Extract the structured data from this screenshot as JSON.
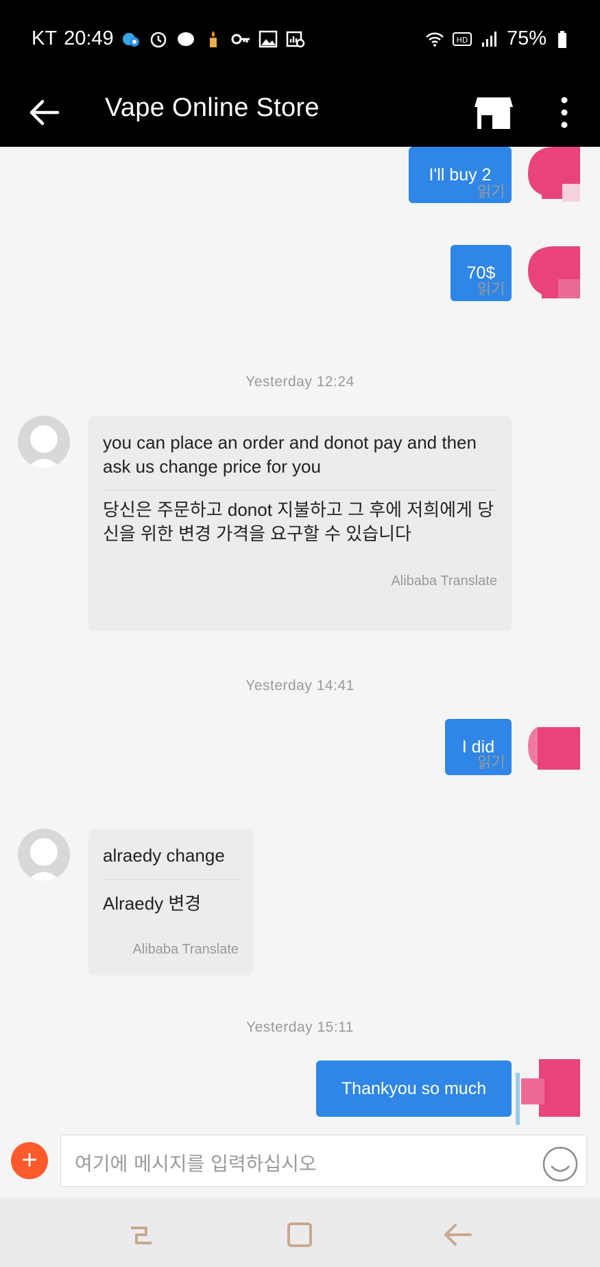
{
  "status_bar": {
    "carrier": "KT",
    "time": "20:49",
    "battery": "75%"
  },
  "header": {
    "title": "Vape Online Store"
  },
  "messages": {
    "m1_text": "I'll buy 2",
    "m1_status": "읽기",
    "m2_text": "70$",
    "m2_status": "읽기",
    "t1": "Yesterday 12:24",
    "m3_original": "you can place an order and donot pay and then ask us change price for you",
    "m3_translation": "당신은 주문하고 donot 지불하고 그 후에 저희에게 당신을 위한 변경 가격을 요구할 수 있습니다",
    "m3_credit": "Alibaba Translate",
    "t2": "Yesterday 14:41",
    "m4_text": "I did",
    "m4_status": "읽기",
    "m5_original": "alraedy change",
    "m5_translation": "Alraedy 변경",
    "m5_credit": "Alibaba Translate",
    "t3": "Yesterday 15:11",
    "m6_text": "Thankyou so much"
  },
  "input": {
    "placeholder": "여기에 메시지를 입력하십시오",
    "add_symbol": "+"
  },
  "colors": {
    "outgoing_bubble": "#2f86e6",
    "incoming_bubble": "#ececec",
    "add_button": "#ff5a2c",
    "avatar_pink": "#e8447a"
  }
}
